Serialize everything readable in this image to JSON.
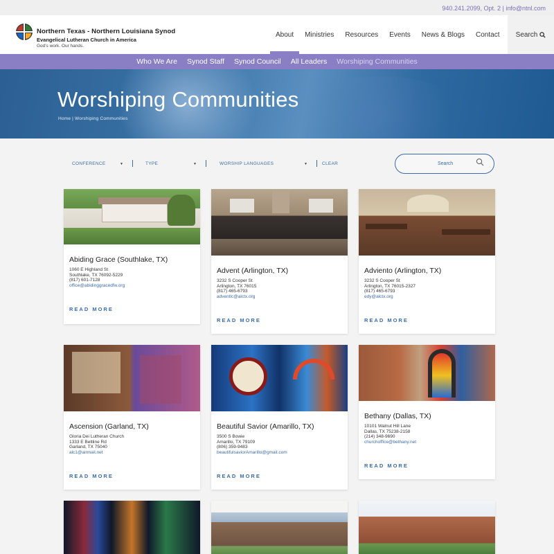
{
  "topbar": {
    "contact": "940.241.2099, Opt. 2 | info@ntnl.com"
  },
  "header": {
    "logo_line1": "Northern Texas - Northern Louisiana Synod",
    "logo_line2": "Evangelical Lutheran Church in America",
    "logo_line3": "God's work. Our hands.",
    "nav": [
      "About",
      "Ministries",
      "Resources",
      "Events",
      "News & Blogs",
      "Contact"
    ],
    "search_label": "Search"
  },
  "subnav": [
    "Who We Are",
    "Synod Staff",
    "Synod Council",
    "All Leaders",
    "Worshiping Communities"
  ],
  "hero": {
    "title": "Worshiping Communities",
    "breadcrumb": "Home | Worshiping Communities"
  },
  "filters": {
    "conference": "CONFERENCE",
    "type": "TYPE",
    "languages": "WORSHIP LANGUAGES",
    "clear": "CLEAR",
    "search_placeholder": "Search"
  },
  "cards": [
    {
      "name": "Abiding Grace (Southlake, TX)",
      "lines": [
        "1060 E Highland St",
        "Southlake, TX 76092-5229",
        "(817) 601-7128"
      ],
      "email": "office@abidinggracedfw.org",
      "more": "READ MORE"
    },
    {
      "name": "Advent (Arlington, TX)",
      "lines": [
        "3232 S Cooper St",
        "Arlington, TX 76015",
        "(817) 465-6793"
      ],
      "email": "adventlc@alctx.org",
      "more": "READ MORE"
    },
    {
      "name": "Adviento (Arlington, TX)",
      "lines": [
        "3232 S Cooper St",
        "Arlington, TX 76015-2327",
        "(817) 465-6793"
      ],
      "email": "edy@alctx.org",
      "more": "READ MORE"
    },
    {
      "name": "Ascension (Garland, TX)",
      "lines": [
        "Gloria Dei Lutheran Church",
        "1333 E Beltline Rd",
        "Garland, TX 75040"
      ],
      "email": "alc1@airmail.net",
      "more": "READ MORE"
    },
    {
      "name": "Beautiful Savior (Amarillo, TX)",
      "lines": [
        "3500 S Bowie",
        "Amarillo, TX 79109",
        "(806) 359-9483"
      ],
      "email": "beautifulsaviorAmarillo@gmail.com",
      "more": "READ MORE"
    },
    {
      "name": "Bethany (Dallas, TX)",
      "lines": [
        "10101 Walnut Hill Lane",
        "Dallas, TX 75238-2158",
        "(214) 348-9690"
      ],
      "email": "churchoffice@bethany.net",
      "more": "READ MORE"
    }
  ],
  "colors": {
    "purple": "#8a7fc4",
    "blue": "#3b6ca8",
    "hero": "#2c5f93"
  }
}
